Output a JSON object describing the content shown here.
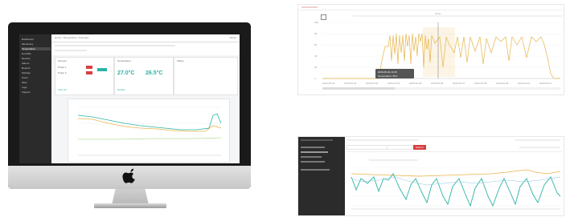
{
  "imac": {
    "screen": {
      "sidebar_items": [
        "Dashboard",
        "Monitoring",
        "Temperature",
        "Humidity",
        "Devices",
        "Alarms",
        "Reports",
        "Settings",
        "Users",
        "Sites",
        "Logs",
        "Support"
      ],
      "top_bar": {
        "breadcrumb": "Home / Temperature / Overview",
        "user": "Admin"
      },
      "cards": [
        {
          "title": "Sensors",
          "rows": [
            "Probe 1",
            "Probe 2"
          ],
          "link": "View all"
        },
        {
          "title": "Temperature",
          "values": [
            "27.0°C",
            "26.5°C"
          ],
          "link": "Details"
        },
        {
          "title": "Status",
          "values": []
        }
      ]
    }
  },
  "panel_top": {
    "title": "Temp",
    "tooltip": [
      "2020-05-04 10:15",
      "Temperature: 60.0"
    ],
    "y_ticks": [
      "0",
      "20",
      "40",
      "60",
      "80",
      "100"
    ],
    "x_ticks": [
      "2020-05-01",
      "2020-05-02",
      "2020-05-03",
      "2020-05-04",
      "2020-05-05",
      "2020-05-06",
      "2020-05-07",
      "2020-05-08",
      "2020-05-09",
      "2020-05-10",
      "2020-05-11"
    ]
  },
  "panel_bottom": {
    "button": "Search",
    "colors": {
      "sidebar": "#2b2b2b",
      "series_a": "#e8b44a",
      "series_b": "#2bb3a6",
      "accent": "#d64040"
    }
  }
}
